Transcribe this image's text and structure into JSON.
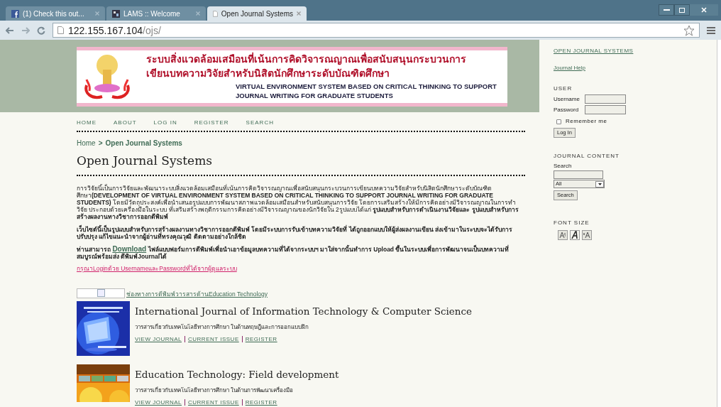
{
  "browser": {
    "tabs": [
      {
        "label": "(1) Check this out...",
        "selected": false
      },
      {
        "label": "LAMS :: Welcome",
        "selected": false
      },
      {
        "label": "Open Journal Systems",
        "selected": true
      }
    ],
    "address": {
      "host": "122.155.167.104",
      "path": "/ojs/"
    }
  },
  "banner": {
    "thai_lines": [
      "ระบบสิ่งแวดล้อมเสมือนที่เน้นการคิดวิจารณญาณเพื่อสนับสนุนกระบวนการ",
      "เขียนบทความวิจัยสำหรับนิสิตนักศึกษาระดับบัณฑิตศึกษา"
    ],
    "english_lines": [
      "VIRTUAL ENVIRONMENT SYSTEM BASED ON CRITICAL THINKING TO SUPPORT",
      "JOURNAL WRITING FOR GRADUATE STUDENTS"
    ]
  },
  "nav": [
    "HOME",
    "ABOUT",
    "LOG IN",
    "REGISTER",
    "SEARCH"
  ],
  "breadcrumb": {
    "home": "Home",
    "separator": ">",
    "current": "Open Journal Systems"
  },
  "page_title": "Open Journal Systems",
  "paragraphs": [
    {
      "text": "การวิจัยนี้เป็นการวิจัยและพัฒนาระบบสิ่งแวดล้อมเสมือนที่เน้นการคิดวิจารณญาณเพื่อสนับสนุนกระบวนการเขียนบทความวิจัยสำหรับนิสิตนักศึกษาระดับบัณฑิตศึกษา**(DEVELOPMENT OF VIRTUAL ENVIRONMENT SYSTEM BASED ON CRITICAL THINKING TO SUPPORT JOURNAL WRITING FOR GRADUATE STUDENTS)** โดยมีวัตถุประสงค์เพื่อนำเสนอรูปแบบการพัฒนาสภาพแวดล้อมเสมือนสำหรับสนับสนุนการวิจัย โดยการเสริมสร้างให้มีการคิดอย่างมีวิจารณญาณในการทำวิจัย ประกอบด้วยเครื่องมือในระบบ ที่เสริมสร้างพฤติกรรมการคิดอย่างมีวิจารณญาณของนักวิจัยใน 2รูปแบบได้แก่ **รูปแบบสำหรับการดำเนินงานวิจัยและ รูปแบบสำหรับการสร้างผลงานทางวิชาการออกตีพิมพ์**"
    },
    {
      "text": "**เว็บไซต์นี้เป็นรูปแบบสำหรับการสร้างผลงานทางวิชาการออกตีพิมพ์ โดยมีระบบการรับเข้าบทความวิจัยที่ ได้ถูกออกแบบให้ผู้ส่งผลงานเขียน ส่งเข้ามาในระบบจะได้รับการปรับปรุง แก้ไขแนะนำจากผู้อ่านที่ทรงคุณวุฒิ ติดตามอย่างใกล้ชิด**"
    },
    {
      "text": "**ท่านสามารถ**",
      "link": "Download",
      "after": "**ไฟล์แบบฟอร์มการตีพิมพ์เพื่อนำเอาข้อมูลบทความที่ได้จากระบบฯ มาใส่จากนั้นทำการ Upload ขึ้นในระบบเพื่อการพัฒนาจนเป็นบทความที่สมบูรณ์พร้อมส่ง ตีพิมพ์Journalได้**"
    }
  ],
  "login_notice": "กรุณาLoginด้วย UsernameและPasswordที่ได้จากผู้ดูแลระบบ",
  "channel_link": "ช่องทางการตีพิมพ์วารสารด้านEducation Technology",
  "journals": [
    {
      "title": "International Journal of Information Technology & Computer Science",
      "description": "วารสารเกี่ยวกับเทคโนโลยีทางการศึกษา ในด้านทฤษฎีและการออกแบบฝึก",
      "links": [
        "VIEW JOURNAL",
        "CURRENT ISSUE",
        "REGISTER"
      ]
    },
    {
      "title": "Education Technology: Field development",
      "description": "วารสารเกี่ยวกับเทคโนโลยีทางการศึกษา ในด้านการพัฒนาเครื่องมือ",
      "links": [
        "VIEW JOURNAL",
        "CURRENT ISSUE",
        "REGISTER"
      ]
    }
  ],
  "sidebar": {
    "links": [
      "OPEN JOURNAL SYSTEMS",
      "Journal Help"
    ],
    "user": {
      "heading": "USER",
      "username_label": "Username",
      "password_label": "Password",
      "remember": {
        "label": "Remember me",
        "checked": false
      },
      "button": "Log In"
    },
    "journal_content": {
      "heading": "JOURNAL CONTENT",
      "search_label": "Search",
      "scope": "All",
      "button": "Search"
    },
    "font_size": {
      "heading": "FONT SIZE"
    }
  }
}
